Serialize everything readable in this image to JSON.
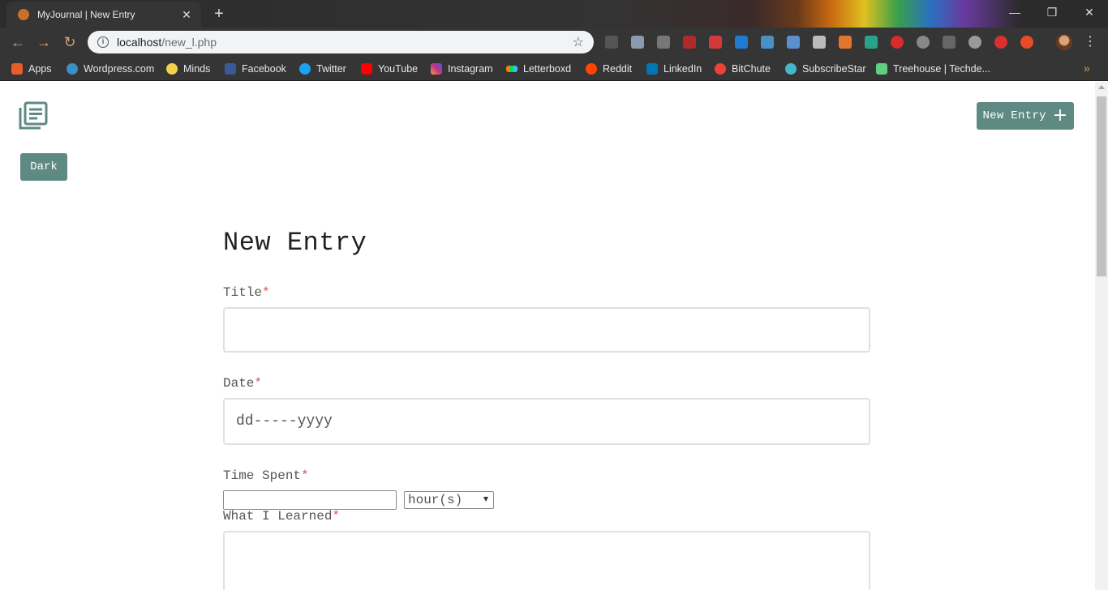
{
  "browser": {
    "tab_title": "MyJournal | New Entry",
    "url_host": "localhost",
    "url_path": "/new_l.php",
    "bookmarks": [
      {
        "label": "Apps",
        "icon": "apps-grid-icon",
        "color": "#e85d2a"
      },
      {
        "label": "Wordpress.com",
        "icon": "wordpress-icon",
        "color": "#3a8fc4"
      },
      {
        "label": "Minds",
        "icon": "lightbulb-icon",
        "color": "#f2d24a"
      },
      {
        "label": "Facebook",
        "icon": "facebook-icon",
        "color": "#3b5998"
      },
      {
        "label": "Twitter",
        "icon": "twitter-icon",
        "color": "#1da1f2"
      },
      {
        "label": "YouTube",
        "icon": "youtube-icon",
        "color": "#ff0000"
      },
      {
        "label": "Instagram",
        "icon": "instagram-icon",
        "color": "#c13584"
      },
      {
        "label": "Letterboxd",
        "icon": "letterboxd-icon",
        "color": "#40bcf4"
      },
      {
        "label": "Reddit",
        "icon": "reddit-icon",
        "color": "#ff4500"
      },
      {
        "label": "LinkedIn",
        "icon": "linkedin-icon",
        "color": "#0077b5"
      },
      {
        "label": "BitChute",
        "icon": "bitchute-icon",
        "color": "#ef4137"
      },
      {
        "label": "SubscribeStar",
        "icon": "subscribestar-icon",
        "color": "#46b7c6"
      },
      {
        "label": "Treehouse | Techde...",
        "icon": "treehouse-icon",
        "color": "#5fcf80"
      }
    ]
  },
  "app": {
    "new_entry_button": "New Entry",
    "dark_button": "Dark",
    "accent_color": "#5f8a83"
  },
  "form": {
    "heading": "New Entry",
    "title_label": "Title",
    "date_label": "Date",
    "date_placeholder": "dd-----yyyy",
    "time_label": "Time Spent",
    "time_unit": "hour(s)",
    "learned_label": "What I Learned",
    "required_mark": "*"
  }
}
